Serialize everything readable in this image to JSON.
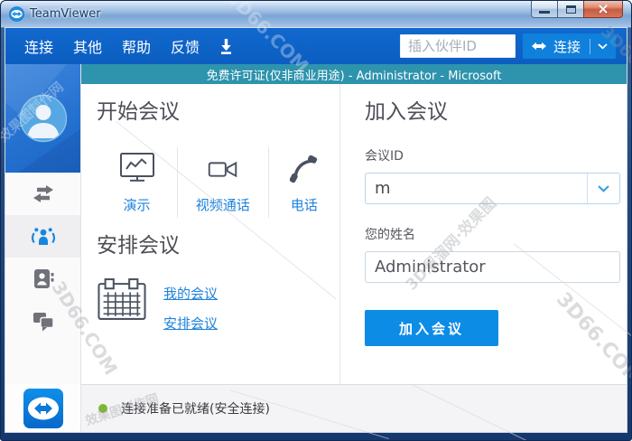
{
  "window": {
    "title": "TeamViewer",
    "controls": {
      "minimize": "minimize",
      "maximize": "maximize",
      "close": "close"
    }
  },
  "menubar": {
    "items": [
      {
        "label": "连接"
      },
      {
        "label": "其他"
      },
      {
        "label": "帮助"
      },
      {
        "label": "反馈"
      }
    ],
    "partner_id_placeholder": "插入伙伴ID",
    "connect_button_label": "连接"
  },
  "license_bar": {
    "text": "免费许可证(仅非商业用途) - Administrator - Microsoft"
  },
  "sidebar": {
    "items": [
      {
        "name": "remote-control",
        "active": false
      },
      {
        "name": "meeting",
        "active": true
      },
      {
        "name": "contacts",
        "active": false
      },
      {
        "name": "chat",
        "active": false
      }
    ]
  },
  "start_meeting": {
    "title": "开始会议",
    "actions": [
      {
        "label": "演示"
      },
      {
        "label": "视频通话"
      },
      {
        "label": "电话"
      }
    ]
  },
  "schedule_meeting": {
    "title": "安排会议",
    "links": [
      {
        "label": "我的会议"
      },
      {
        "label": "安排会议"
      }
    ]
  },
  "join_meeting": {
    "title": "加入会议",
    "meeting_id_label": "会议ID",
    "meeting_id_value": "m",
    "name_label": "您的姓名",
    "name_value": "Administrator",
    "join_button_label": "加入会议"
  },
  "status_bar": {
    "text": "连接准备已就绪(安全连接)"
  },
  "icons": {
    "titlebar-app-icon": "teamviewer-logo",
    "download-icon": "download-arrow",
    "connect-arrows-icon": "double-arrow",
    "remote-control-icon": "swap-arrows",
    "meeting-icon": "person-group",
    "contacts-icon": "address-book",
    "chat-icon": "chat-bubbles",
    "presentation-icon": "monitor-chart",
    "video-call-icon": "video-camera",
    "phone-icon": "phone-handset",
    "calendar-icon": "calendar-grid",
    "chevron-down-icon": "chevron-down"
  },
  "colors": {
    "accent": "#0d8ce6",
    "menubar": "#0d64c8",
    "license_bar": "#2e93ad",
    "link": "#1e82dd",
    "status_green": "#7db832"
  },
  "watermarks": {
    "wm1": "3D66.COM",
    "wm2": "3D溜溜网·效果图",
    "wm3": "效果图制作网",
    "wm4": "3D66.COM",
    "wm5": "3D66.COM",
    "wm6": "3D66.COM",
    "wm7": "效果图制作网"
  }
}
